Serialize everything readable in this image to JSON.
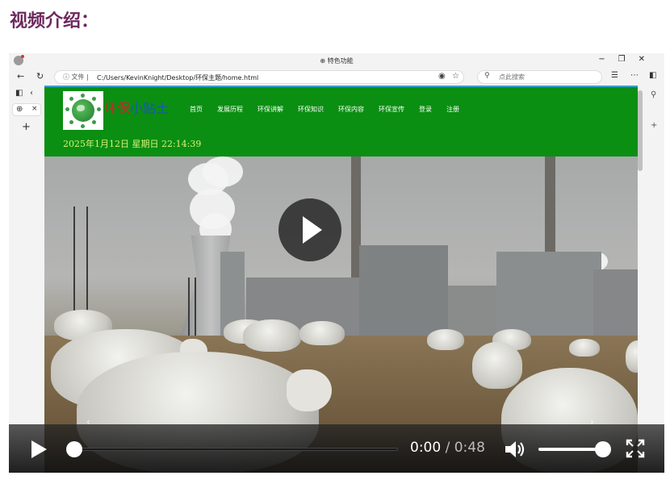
{
  "page": {
    "heading": "视频介绍："
  },
  "browser": {
    "tab_title": "特色功能",
    "address": {
      "scheme_label": "文件",
      "url": "C:/Users/KevinKnight/Desktop/环保主题/home.html"
    },
    "search": {
      "placeholder": "点此搜索"
    },
    "window_controls": {
      "minimize": "−",
      "restore": "❐",
      "close": "✕"
    }
  },
  "website": {
    "logo_text_red": "环保",
    "logo_text_blue": "小贴士",
    "nav": [
      "首页",
      "发展历程",
      "环保讲解",
      "环保知识",
      "环保内容",
      "环保宣传",
      "登录",
      "注册"
    ],
    "datetime": "2025年1月12日 星期日 22:14:39"
  },
  "video": {
    "current_time": "0:00",
    "separator": "/",
    "duration": "0:48",
    "progress_fraction": 0.0,
    "volume_fraction": 1.0
  },
  "colors": {
    "heading": "#6d2a5e",
    "site_header": "#0a8f12",
    "logo_red": "#c62828",
    "logo_blue": "#1b56b8",
    "date_text": "#d9f07a"
  },
  "icons": {
    "back": "back-arrow-icon",
    "refresh": "refresh-icon",
    "info": "info-icon",
    "read_aloud": "read-aloud-icon",
    "favorite": "star-icon",
    "search": "search-icon",
    "favorites_bar": "favorites-icon",
    "more": "more-icon",
    "sidebar": "sidebar-icon",
    "play": "play-icon",
    "volume": "volume-icon",
    "fullscreen": "fullscreen-icon"
  }
}
